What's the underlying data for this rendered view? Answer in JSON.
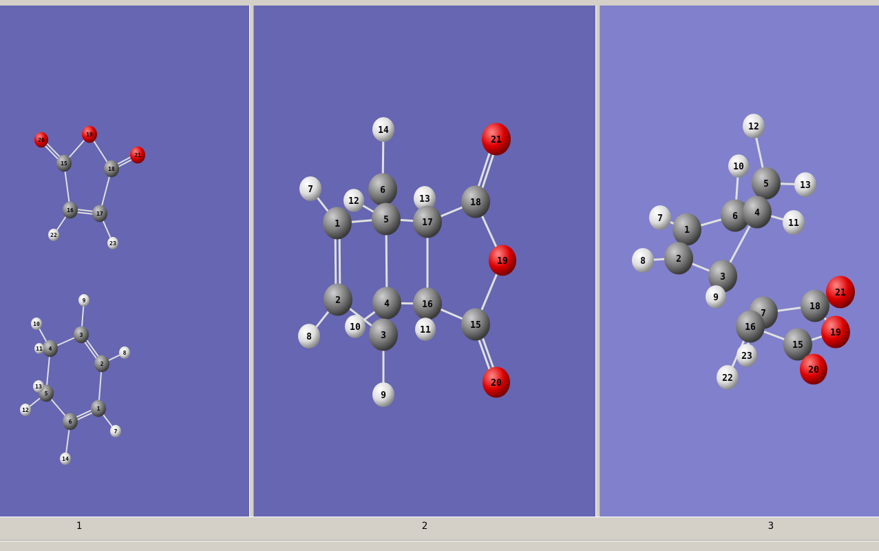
{
  "colors": {
    "panel_bg": "#6666b2",
    "panel3_bg": "#8080cc",
    "carbon": "#7a7a7a",
    "hydrogen": "#dcdcdc",
    "oxygen": "#dd0000",
    "bond": "#e0e0e0"
  },
  "panels": [
    {
      "label": "1",
      "atoms": [
        {
          "id": "20",
          "el": "O",
          "label": "20"
        },
        {
          "id": "19",
          "el": "O",
          "label": "19"
        },
        {
          "id": "21",
          "el": "O",
          "label": "21"
        },
        {
          "id": "15",
          "el": "C",
          "label": "15"
        },
        {
          "id": "18",
          "el": "C",
          "label": "18"
        },
        {
          "id": "16",
          "el": "C",
          "label": "16"
        },
        {
          "id": "17",
          "el": "C",
          "label": "17"
        },
        {
          "id": "22",
          "el": "H",
          "label": "22"
        },
        {
          "id": "23",
          "el": "H",
          "label": "23"
        },
        {
          "id": "c1",
          "el": "C",
          "label": "1"
        },
        {
          "id": "c2",
          "el": "C",
          "label": "2"
        },
        {
          "id": "c3",
          "el": "C",
          "label": "3"
        },
        {
          "id": "c4",
          "el": "C",
          "label": "4"
        },
        {
          "id": "c5",
          "el": "C",
          "label": "5"
        },
        {
          "id": "c6",
          "el": "C",
          "label": "6"
        },
        {
          "id": "h7",
          "el": "H",
          "label": "7"
        },
        {
          "id": "h8",
          "el": "H",
          "label": "8"
        },
        {
          "id": "h9",
          "el": "H",
          "label": "9"
        },
        {
          "id": "h10",
          "el": "H",
          "label": "10"
        },
        {
          "id": "h11",
          "el": "H",
          "label": "11"
        },
        {
          "id": "h12",
          "el": "H",
          "label": "12"
        },
        {
          "id": "h13",
          "el": "H",
          "label": "13"
        },
        {
          "id": "h14",
          "el": "H",
          "label": "14"
        }
      ]
    },
    {
      "label": "2",
      "atoms": [
        {
          "id": "14",
          "el": "H",
          "label": "14"
        },
        {
          "id": "7",
          "el": "H",
          "label": "7"
        },
        {
          "id": "12",
          "el": "H",
          "label": "12"
        },
        {
          "id": "6",
          "el": "C",
          "label": "6"
        },
        {
          "id": "13",
          "el": "H",
          "label": "13"
        },
        {
          "id": "1",
          "el": "C",
          "label": "1"
        },
        {
          "id": "5",
          "el": "C",
          "label": "5"
        },
        {
          "id": "17",
          "el": "C",
          "label": "17"
        },
        {
          "id": "18",
          "el": "C",
          "label": "18"
        },
        {
          "id": "21",
          "el": "O",
          "label": "21"
        },
        {
          "id": "19",
          "el": "O",
          "label": "19"
        },
        {
          "id": "2",
          "el": "C",
          "label": "2"
        },
        {
          "id": "4",
          "el": "C",
          "label": "4"
        },
        {
          "id": "16",
          "el": "C",
          "label": "16"
        },
        {
          "id": "15",
          "el": "C",
          "label": "15"
        },
        {
          "id": "10",
          "el": "H",
          "label": "10"
        },
        {
          "id": "3",
          "el": "C",
          "label": "3"
        },
        {
          "id": "11",
          "el": "H",
          "label": "11"
        },
        {
          "id": "8",
          "el": "H",
          "label": "8"
        },
        {
          "id": "20",
          "el": "O",
          "label": "20"
        },
        {
          "id": "9",
          "el": "H",
          "label": "9"
        }
      ]
    },
    {
      "label": "3",
      "atoms": [
        {
          "id": "12",
          "el": "H",
          "label": "12"
        },
        {
          "id": "10",
          "el": "H",
          "label": "10"
        },
        {
          "id": "5",
          "el": "C",
          "label": "5"
        },
        {
          "id": "13",
          "el": "H",
          "label": "13"
        },
        {
          "id": "7",
          "el": "H",
          "label": "7"
        },
        {
          "id": "1",
          "el": "C",
          "label": "1"
        },
        {
          "id": "6",
          "el": "C",
          "label": "6"
        },
        {
          "id": "4",
          "el": "C",
          "label": "4"
        },
        {
          "id": "11",
          "el": "H",
          "label": "11"
        },
        {
          "id": "8",
          "el": "H",
          "label": "8"
        },
        {
          "id": "2",
          "el": "C",
          "label": "2"
        },
        {
          "id": "3",
          "el": "C",
          "label": "3"
        },
        {
          "id": "9",
          "el": "H",
          "label": "9"
        },
        {
          "id": "21",
          "el": "O",
          "label": "21"
        },
        {
          "id": "18",
          "el": "C",
          "label": "18"
        },
        {
          "id": "17",
          "el": "C",
          "label": "7"
        },
        {
          "id": "16",
          "el": "C",
          "label": "16"
        },
        {
          "id": "19",
          "el": "O",
          "label": "19"
        },
        {
          "id": "15",
          "el": "C",
          "label": "15"
        },
        {
          "id": "23",
          "el": "H",
          "label": "23"
        },
        {
          "id": "20",
          "el": "O",
          "label": "20"
        },
        {
          "id": "22",
          "el": "H",
          "label": "22"
        }
      ]
    }
  ]
}
